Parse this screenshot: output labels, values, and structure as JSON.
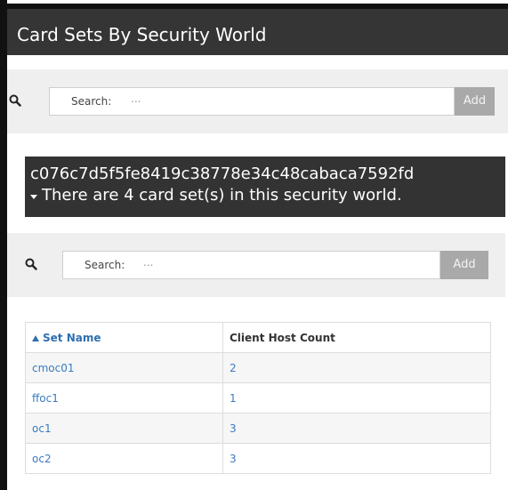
{
  "header": {
    "title": "Card Sets By Security World"
  },
  "search1": {
    "label": "Search:",
    "placeholder": "...",
    "add_label": "Add"
  },
  "banner": {
    "world_id": "c076c7d5f5fe8419c38778e34c48cabaca7592fd",
    "summary": "There are 4 card set(s) in this security world."
  },
  "search2": {
    "label": "Search:",
    "placeholder": "...",
    "add_label": "Add"
  },
  "table": {
    "columns": [
      "Set Name",
      "Client Host Count"
    ],
    "rows": [
      {
        "name": "cmoc01",
        "count": "2"
      },
      {
        "name": "ffoc1",
        "count": "1"
      },
      {
        "name": "oc1",
        "count": "3"
      },
      {
        "name": "oc2",
        "count": "3"
      }
    ]
  },
  "icons": {
    "search": "search-icon",
    "sort": "sort-ascending-icon",
    "expand": "caret-down-icon"
  },
  "colors": {
    "header_bg": "#353535",
    "link": "#3a7bbf",
    "button": "#a9a9a9"
  }
}
